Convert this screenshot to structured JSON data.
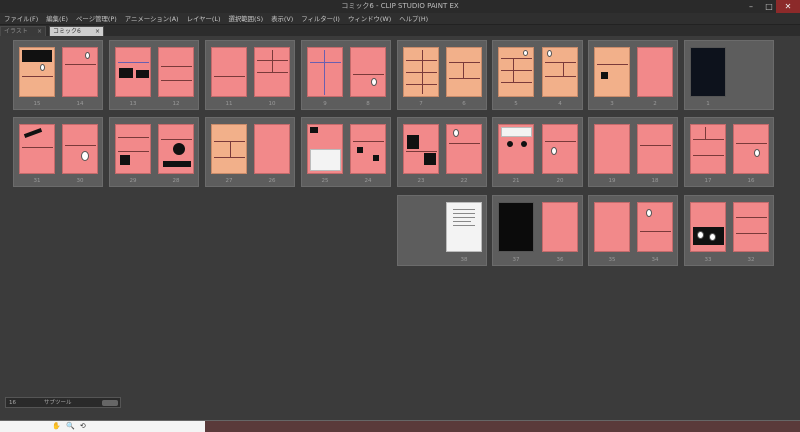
{
  "window": {
    "title": "コミック6 - CLIP STUDIO PAINT EX",
    "controls": [
      "–",
      "□",
      "✕"
    ]
  },
  "menu": [
    "ファイル(F)",
    "編集(E)",
    "ページ管理(P)",
    "アニメーション(A)",
    "レイヤー(L)",
    "選択範囲(S)",
    "表示(V)",
    "フィルター(I)",
    "ウィンドウ(W)",
    "ヘルプ(H)"
  ],
  "tabs": [
    {
      "label": "イラスト",
      "close": "×"
    },
    {
      "label": "コミック6",
      "close": "×"
    }
  ],
  "pages": {
    "row1": [
      "15",
      "14",
      "13",
      "12",
      "11",
      "10",
      "9",
      "8",
      "7",
      "6",
      "5",
      "4",
      "3",
      "2",
      "1"
    ],
    "row2": [
      "31",
      "30",
      "29",
      "28",
      "27",
      "26",
      "25",
      "24",
      "23",
      "22",
      "21",
      "20",
      "19",
      "18",
      "17",
      "16"
    ],
    "row3": [
      "38",
      "37",
      "36",
      "35",
      "34",
      "33",
      "32"
    ]
  },
  "zoom": {
    "value": "16",
    "mode": "サブツール"
  },
  "status": {
    "icons": [
      "✋",
      "🔍",
      "⟲"
    ]
  }
}
